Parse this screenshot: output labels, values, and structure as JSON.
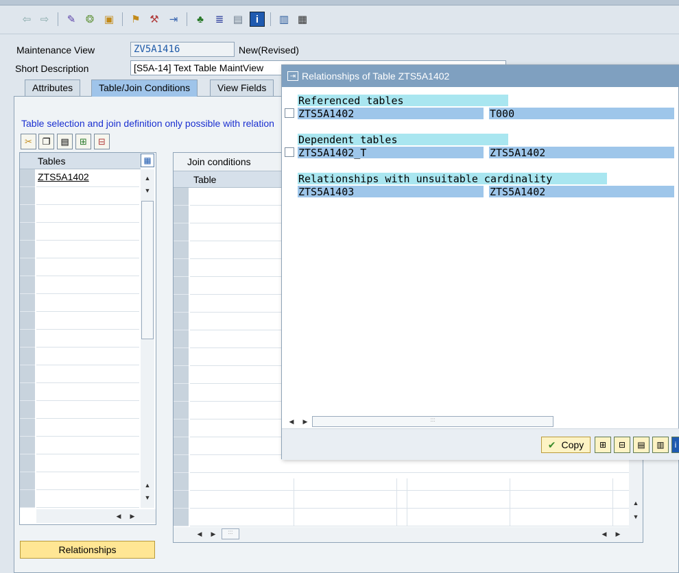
{
  "toolbar": {
    "icons": [
      "back-arrow-icon",
      "forward-arrow-icon",
      "display-change-icon",
      "other-object-icon",
      "activate-icon",
      "check-icon",
      "where-used-icon",
      "object-list-icon",
      "navigation-icon",
      "hierarchy-icon",
      "layout-icon",
      "info-icon",
      "table-structure-icon",
      "table-contents-icon"
    ]
  },
  "header": {
    "maint_view_label": "Maintenance View",
    "maint_view_value": "ZV5A1416",
    "maint_view_status": "New(Revised)",
    "short_desc_label": "Short Description",
    "short_desc_value": "[S5A-14] Text Table MaintView"
  },
  "tabs": [
    {
      "label": "Attributes"
    },
    {
      "label": "Table/Join Conditions"
    },
    {
      "label": "View Fields"
    }
  ],
  "info_text": "Table selection and join definition only possible with relation",
  "tables_grid": {
    "header": "Tables",
    "rows": [
      "ZTS5A1402"
    ]
  },
  "join_grid": {
    "title": "Join conditions",
    "header": "Table"
  },
  "relationships_button": "Relationships",
  "dialog": {
    "title": "Relationships of Table ZTS5A1402",
    "referenced_header": "Referenced tables",
    "referenced_rows": [
      {
        "col1": "ZTS5A1402",
        "col2": "T000"
      }
    ],
    "dependent_header": "Dependent tables",
    "dependent_rows": [
      {
        "col1": "ZTS5A1402_T",
        "col2": "ZTS5A1402"
      }
    ],
    "unsuitable_header": "Relationships with unsuitable cardinality",
    "unsuitable_rows": [
      {
        "col1": "ZTS5A1403",
        "col2": "ZTS5A1402"
      }
    ],
    "copy_label": "Copy"
  },
  "colors": {
    "section_header": "#a9e6f0",
    "row_fill": "#9ec6ea",
    "dialog_title_bg": "#7fa0c0",
    "button_yellow": "#ffe694"
  }
}
